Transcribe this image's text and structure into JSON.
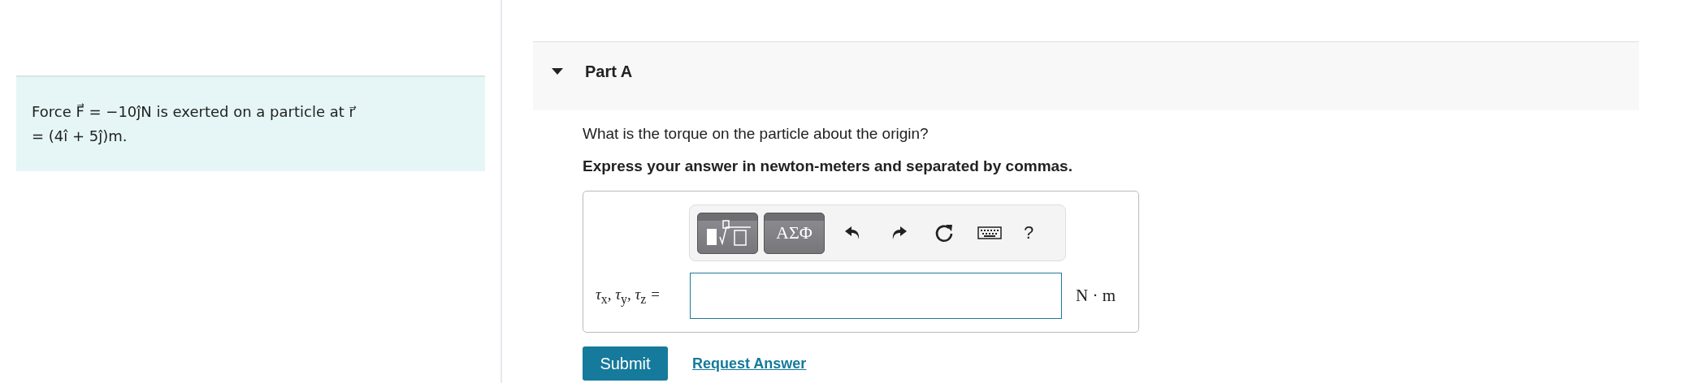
{
  "problem": {
    "text": "Force F⃗ = −10ĵN is exerted on a particle at r⃗ = (4î + 5ĵ)m."
  },
  "part": {
    "title": "Part A",
    "expanded": true
  },
  "question": "What is the torque on the particle about the origin?",
  "instruction": "Express your answer in newton-meters and separated by commas.",
  "toolbar": [
    {
      "kind": "template"
    },
    {
      "kind": "symbols",
      "label": "ΑΣΦ"
    },
    {
      "kind": "undo"
    },
    {
      "kind": "redo"
    },
    {
      "kind": "reset"
    },
    {
      "kind": "keyboard"
    },
    {
      "kind": "help",
      "label": "?"
    }
  ],
  "answer": {
    "label": "τ$_{x}$, τ$_{y}$, τ$_{z}$ =",
    "units": "N · m"
  },
  "buttons": {
    "submit": "Submit",
    "request": "Request Answer"
  }
}
